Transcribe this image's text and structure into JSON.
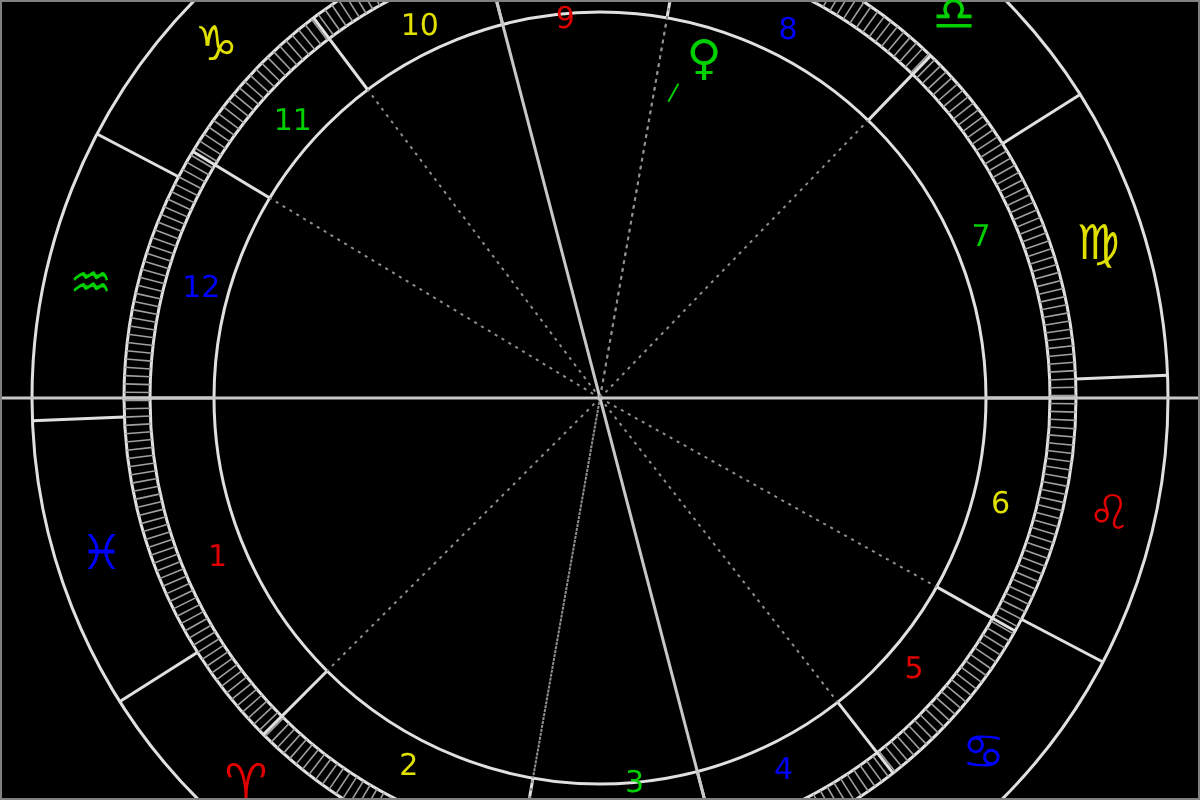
{
  "houses": [
    {
      "kind": "tenth",
      "number": "10",
      "color": "#e0e000"
    },
    {
      "kind": "ninth",
      "number": "9",
      "color": "#e00000"
    },
    {
      "kind": "eighth",
      "number": "8",
      "color": "#0000ff"
    },
    {
      "kind": "eleventh",
      "number": "11",
      "color": "#00d000"
    },
    {
      "kind": "seventh",
      "number": "7",
      "color": "#00d000"
    },
    {
      "kind": "twelfth",
      "number": "12",
      "color": "#0000ff"
    },
    {
      "kind": "sixth",
      "number": "6",
      "color": "#e0e000"
    },
    {
      "kind": "first",
      "number": "1",
      "color": "#e00000"
    },
    {
      "kind": "fifth",
      "number": "5",
      "color": "#e00000"
    },
    {
      "kind": "second",
      "number": "2",
      "color": "#e0e000"
    },
    {
      "kind": "fourth",
      "number": "4",
      "color": "#0000ff"
    },
    {
      "kind": "third",
      "number": "3",
      "color": "#00d000"
    }
  ],
  "signs": [
    {
      "kind": "capricorn",
      "glyph": "♑",
      "color": "#e0e000"
    },
    {
      "kind": "libra",
      "glyph": "♎",
      "color": "#00d000"
    },
    {
      "kind": "virgo",
      "glyph": "♍",
      "color": "#e0e000"
    },
    {
      "kind": "aquarius",
      "glyph": "♒",
      "color": "#00d000"
    },
    {
      "kind": "pisces",
      "glyph": "♓",
      "color": "#0000ff"
    },
    {
      "kind": "leo",
      "glyph": "♌",
      "color": "#e00000"
    },
    {
      "kind": "aries",
      "glyph": "♈",
      "color": "#e00000"
    },
    {
      "kind": "cancer",
      "glyph": "♋",
      "color": "#0000ff"
    }
  ],
  "planets": [
    {
      "kind": "venus",
      "glyph": "♀",
      "color": "#00d000"
    }
  ]
}
